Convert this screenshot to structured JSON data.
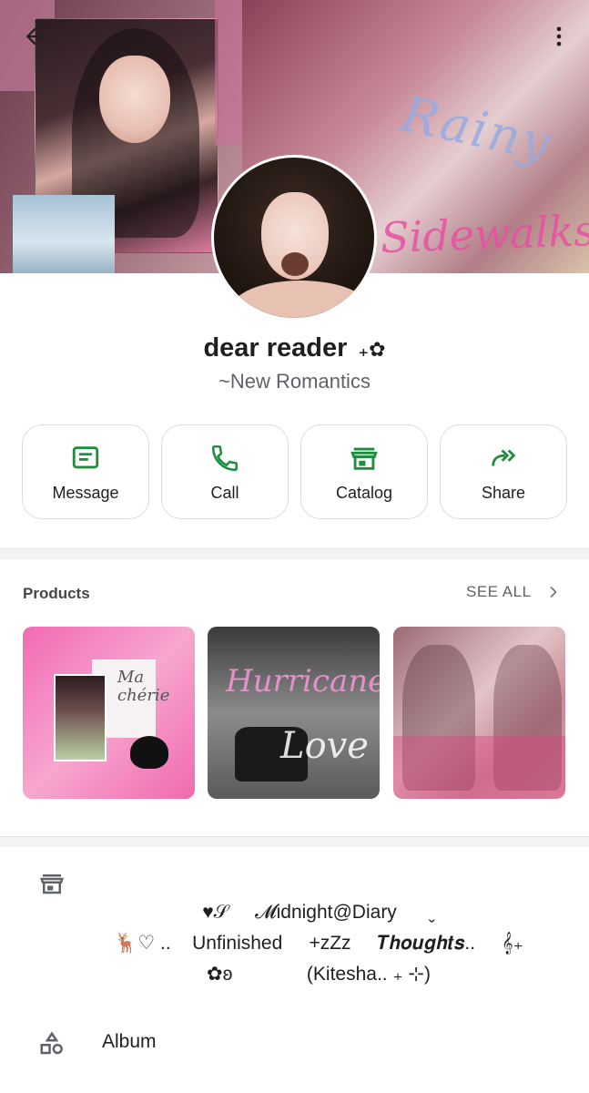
{
  "header": {
    "banner_text_1": "Rainy",
    "banner_text_2": "Sidewalks",
    "back_icon": "arrow-left-icon",
    "more_icon": "more-vert-icon"
  },
  "profile": {
    "name": "dear reader",
    "name_suffix": "₊✿",
    "subtitle": "~New Romantics"
  },
  "actions": [
    {
      "label": "Message",
      "icon": "message-icon"
    },
    {
      "label": "Call",
      "icon": "phone-icon"
    },
    {
      "label": "Catalog",
      "icon": "storefront-icon"
    },
    {
      "label": "Share",
      "icon": "share-forward-icon"
    }
  ],
  "products": {
    "title": "Products",
    "see_all": "SEE ALL",
    "items": [
      {
        "overlay_text": "Ma chérie"
      },
      {
        "overlay_text_1": "Hurricane",
        "overlay_text_2": "Love"
      },
      {
        "overlay_text": ""
      }
    ]
  },
  "description": {
    "line1": "♥𝒮     𝓜idnight@Diary      ˬ",
    "line2": "🦌♡ ..    Unfinished     +zZz     𝑻𝒉𝒐𝒖𝒈𝒉𝒕𝒔..     𝄞₊",
    "line3": "✿ʚ              (Kitesha.. ₊ ⊹)"
  },
  "album": {
    "label": "Album",
    "icon": "shapes-icon"
  },
  "colors": {
    "accent": "#1e8e3e",
    "divider": "#f1f3f4",
    "border": "#dadce0"
  }
}
